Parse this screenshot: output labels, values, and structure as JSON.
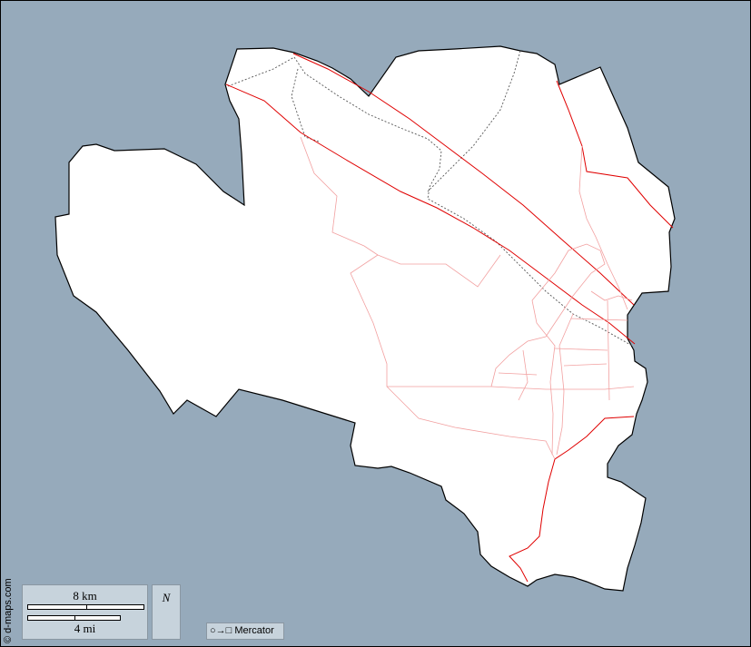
{
  "map": {
    "credit": "© d-maps.com",
    "scale": {
      "km_label": "8 km",
      "mi_label": "4 mi"
    },
    "north_label": "N",
    "projection": {
      "symbol": "○→□",
      "label": "Mercator"
    },
    "colors": {
      "water": "#96aabb",
      "land": "#ffffff",
      "major_road": "#e00000",
      "minor_road": "#f2a0a0",
      "railway": "#555555",
      "legend_box": "#c7d3dc"
    }
  }
}
